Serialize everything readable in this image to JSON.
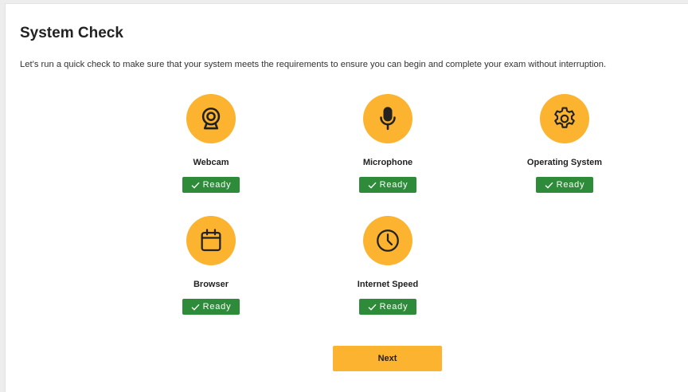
{
  "page": {
    "title": "System Check",
    "intro": "Let’s run a quick check to make sure that your system meets the requirements to ensure you can begin and complete your exam without interruption."
  },
  "checks": [
    {
      "label": "Webcam",
      "status": "Ready",
      "icon": "webcam-icon"
    },
    {
      "label": "Microphone",
      "status": "Ready",
      "icon": "microphone-icon"
    },
    {
      "label": "Operating System",
      "status": "Ready",
      "icon": "gear-icon"
    },
    {
      "label": "Browser",
      "status": "Ready",
      "icon": "calendar-icon"
    },
    {
      "label": "Internet Speed",
      "status": "Ready",
      "icon": "clock-icon"
    }
  ],
  "actions": {
    "next_label": "Next"
  },
  "colors": {
    "accent": "#fbb330",
    "ready_badge": "#2e8b3a",
    "text": "#222222"
  }
}
